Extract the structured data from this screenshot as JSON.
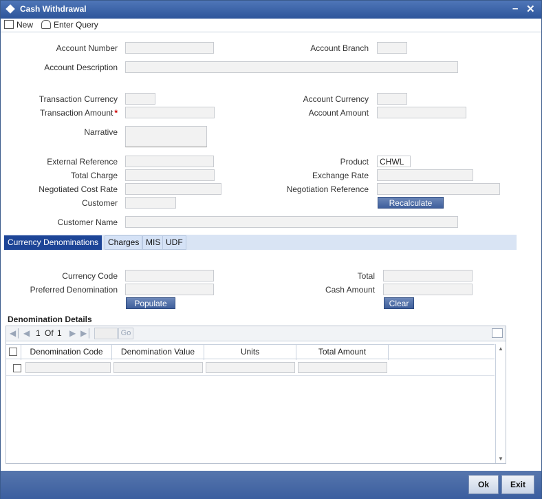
{
  "window": {
    "title": "Cash Withdrawal"
  },
  "toolbar": {
    "new_label": "New",
    "enter_query_label": "Enter Query"
  },
  "form": {
    "account_number_label": "Account Number",
    "account_branch_label": "Account Branch",
    "account_description_label": "Account Description",
    "transaction_currency_label": "Transaction Currency",
    "account_currency_label": "Account Currency",
    "transaction_amount_label": "Transaction Amount",
    "required_mark": "*",
    "account_amount_label": "Account Amount",
    "narrative_label": "Narrative",
    "external_reference_label": "External Reference",
    "product_label": "Product",
    "product_value": "CHWL",
    "total_charge_label": "Total Charge",
    "exchange_rate_label": "Exchange Rate",
    "negotiated_cost_rate_label": "Negotiated Cost Rate",
    "negotiation_reference_label": "Negotiation Reference",
    "customer_label": "Customer",
    "recalculate_label": "Recalculate",
    "customer_name_label": "Customer Name"
  },
  "tabs": [
    {
      "label": "Currency Denominations"
    },
    {
      "label": "Charges"
    },
    {
      "label": "MIS"
    },
    {
      "label": "UDF"
    }
  ],
  "denom": {
    "currency_code_label": "Currency Code",
    "total_label": "Total",
    "preferred_denomination_label": "Preferred Denomination",
    "cash_amount_label": "Cash Amount",
    "populate_label": "Populate",
    "clear_label": "Clear"
  },
  "grid": {
    "title": "Denomination Details",
    "page_current": "1",
    "page_of": "Of",
    "page_total": "1",
    "go_label": "Go",
    "columns": [
      "Denomination Code",
      "Denomination Value",
      "Units",
      "Total Amount"
    ]
  },
  "footer": {
    "ok_label": "Ok",
    "exit_label": "Exit"
  },
  "colors": {
    "titlebar": "#2d559a",
    "tab_active": "#1d4597",
    "footer": "#3b5e9f"
  }
}
